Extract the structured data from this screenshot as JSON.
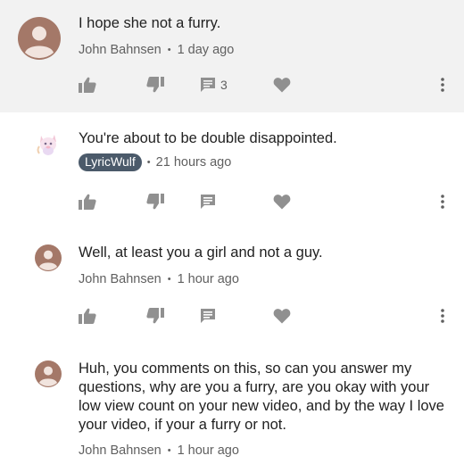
{
  "comments": [
    {
      "text": "I hope she not a furry.",
      "author": "John Bahnsen",
      "author_is_badge": false,
      "time": "1 day ago",
      "reply_count": "3",
      "highlighted": true
    },
    {
      "text": "You're about to be double disappointed.",
      "author": "LyricWulf",
      "author_is_badge": true,
      "time": "21 hours ago"
    },
    {
      "text": "Well, at least you a girl and not a guy.",
      "author": "John Bahnsen",
      "author_is_badge": false,
      "time": "1 hour ago"
    },
    {
      "text": "Huh, you comments on this, so can you answer my questions, why are you a furry, are you okay with your low view count on your new video, and by the way I love your video, if your a furry or not.",
      "author": "John Bahnsen",
      "author_is_badge": false,
      "time": "1 hour ago"
    }
  ],
  "separator": "•",
  "icons": {
    "like": "thumbs-up-icon",
    "dislike": "thumbs-down-icon",
    "reply": "reply-comment-icon",
    "heart": "heart-icon",
    "more": "more-vertical-icon",
    "avatar": "default-avatar-icon",
    "creator_avatar": "creator-avatar-image"
  },
  "colors": {
    "highlight_bg": "#f2f2f2",
    "icon": "#909090",
    "badge_bg": "#4b5a6a",
    "meta_text": "#606060"
  }
}
